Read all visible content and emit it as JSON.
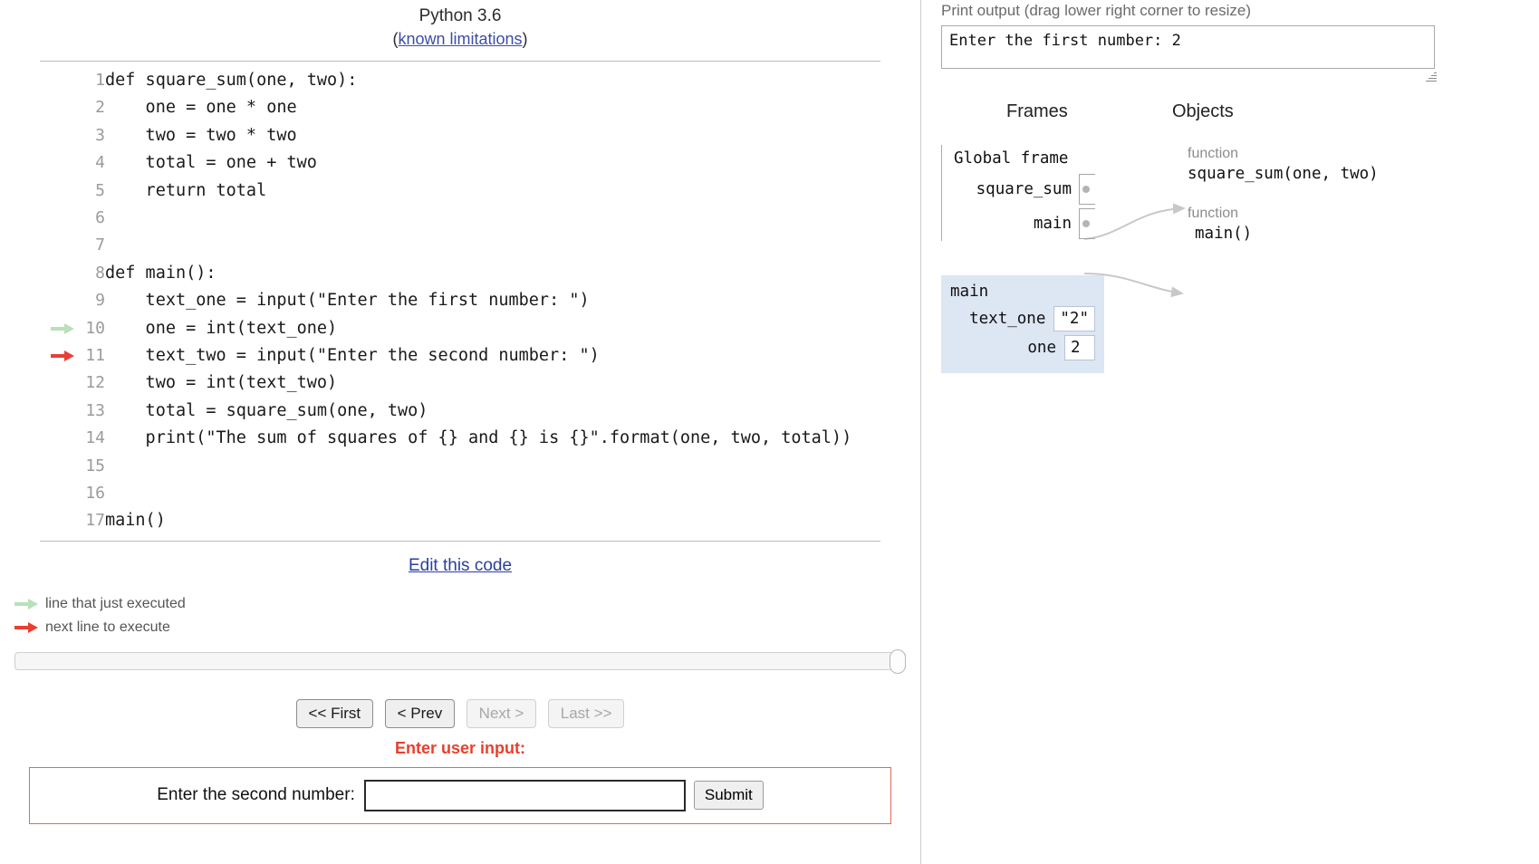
{
  "header": {
    "language": "Python 3.6",
    "limitations_prefix": "(",
    "limitations_link": "known limitations",
    "limitations_suffix": ")"
  },
  "code": {
    "lines": [
      {
        "n": "1",
        "text": "def square_sum(one, two):",
        "marker": ""
      },
      {
        "n": "2",
        "text": "    one = one * one",
        "marker": ""
      },
      {
        "n": "3",
        "text": "    two = two * two",
        "marker": ""
      },
      {
        "n": "4",
        "text": "    total = one + two",
        "marker": ""
      },
      {
        "n": "5",
        "text": "    return total",
        "marker": ""
      },
      {
        "n": "6",
        "text": "",
        "marker": ""
      },
      {
        "n": "7",
        "text": "",
        "marker": ""
      },
      {
        "n": "8",
        "text": "def main():",
        "marker": ""
      },
      {
        "n": "9",
        "text": "    text_one = input(\"Enter the first number: \")",
        "marker": ""
      },
      {
        "n": "10",
        "text": "    one = int(text_one)",
        "marker": "executed"
      },
      {
        "n": "11",
        "text": "    text_two = input(\"Enter the second number: \")",
        "marker": "next"
      },
      {
        "n": "12",
        "text": "    two = int(text_two)",
        "marker": ""
      },
      {
        "n": "13",
        "text": "    total = square_sum(one, two)",
        "marker": ""
      },
      {
        "n": "14",
        "text": "    print(\"The sum of squares of {} and {} is {}\".format(one, two, total))",
        "marker": ""
      },
      {
        "n": "15",
        "text": "",
        "marker": ""
      },
      {
        "n": "16",
        "text": "",
        "marker": ""
      },
      {
        "n": "17",
        "text": "main()",
        "marker": ""
      }
    ]
  },
  "edit_link": "Edit this code",
  "legend": {
    "executed": "line that just executed",
    "next": "next line to execute"
  },
  "nav": {
    "first": "<< First",
    "prev": "< Prev",
    "next": "Next >",
    "last": "Last >>",
    "first_disabled": false,
    "prev_disabled": false,
    "next_disabled": true,
    "last_disabled": true
  },
  "user_input": {
    "title": "Enter user input:",
    "prompt": "Enter the second number:",
    "value": "",
    "placeholder": "",
    "submit": "Submit"
  },
  "print_output": {
    "label": "Print output (drag lower right corner to resize)",
    "text": "Enter the first number: 2"
  },
  "diagram": {
    "frames_header": "Frames",
    "objects_header": "Objects",
    "global_frame_title": "Global frame",
    "global_vars": [
      {
        "name": "square_sum"
      },
      {
        "name": "main"
      }
    ],
    "objects": [
      {
        "kind": "function",
        "signature": "square_sum(one, two)"
      },
      {
        "kind": "function",
        "signature": "main()"
      }
    ],
    "stack_frame": {
      "title": "main",
      "vars": [
        {
          "name": "text_one",
          "value": "\"2\""
        },
        {
          "name": "one",
          "value": "2"
        }
      ]
    }
  },
  "colors": {
    "executed_arrow": "#b9e0b9",
    "next_arrow": "#e93f33",
    "frame_bg": "#dde6f3",
    "alert_red": "#e8402c",
    "link_blue": "#2a3fa0"
  }
}
